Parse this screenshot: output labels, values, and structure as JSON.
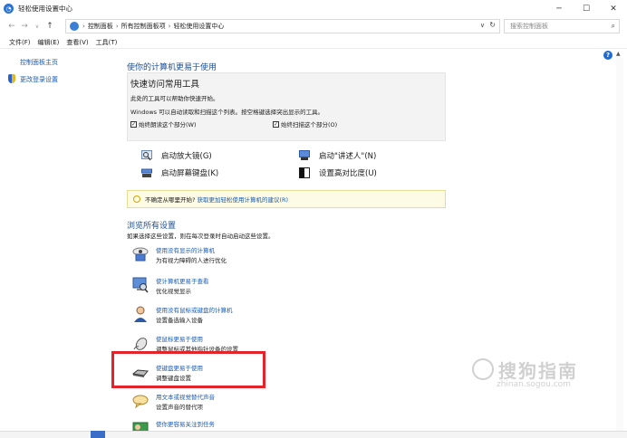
{
  "window": {
    "title": "轻松使用设置中心",
    "controls": {
      "minimize": "─",
      "maximize": "☐",
      "close": "✕"
    }
  },
  "address": {
    "back": "←",
    "forward": "→",
    "up": "↑",
    "crumbs": [
      "控制面板",
      "所有控制面板项",
      "轻松使用设置中心"
    ],
    "separator": "›",
    "dropdown": "∨",
    "refresh": "↻",
    "search_placeholder": "搜索控制面板",
    "search_icon": "⌕"
  },
  "menu": [
    "文件(F)",
    "编辑(E)",
    "查看(V)",
    "工具(T)"
  ],
  "sidebar": {
    "home": "控制面板主页",
    "change_login": "更改登录设置"
  },
  "help": "?",
  "main": {
    "heading": "使你的计算机更易于使用",
    "quick": {
      "title": "快速访问常用工具",
      "line1": "此处的工具可以帮助你快速开始。",
      "line2": "Windows 可以自动读取和扫描这个列表。按空格键选择突出显示的工具。",
      "check1": "始终朗读这个部分(W)",
      "check2": "始终扫描这个部分(O)",
      "checkmark": "✓"
    },
    "tools": {
      "magnifier": "启动放大镜(G)",
      "narrator": "启动\"讲述人\"(N)",
      "osk": "启动屏幕键盘(K)",
      "contrast": "设置高对比度(U)"
    },
    "tip": {
      "text": "不确定从哪里开始?",
      "link": "获取更加轻松使用计算机的建议(R)"
    },
    "browse_heading": "浏览所有设置",
    "browse_sub": "如果选择这些设置，则在每次登录时自动启动这些设置。",
    "settings": [
      {
        "link": "使用没有显示的计算机",
        "desc": "为有视力障碍的人进行优化"
      },
      {
        "link": "使计算机更易于查看",
        "desc": "优化视觉显示"
      },
      {
        "link": "使用没有鼠标或键盘的计算机",
        "desc": "设置备选输入设备"
      },
      {
        "link": "使鼠标更易于使用",
        "desc": "调整鼠标或其他指针设备的设置"
      },
      {
        "link": "使键盘更易于使用",
        "desc": "调整键盘设置"
      },
      {
        "link": "用文本或视觉替代声音",
        "desc": "设置声音的替代项"
      },
      {
        "link": "使你更容易关注到任务",
        "desc": ""
      }
    ]
  },
  "watermark": {
    "brand": "搜狗指南",
    "url": "zhinan.sogou.com"
  },
  "colors": {
    "link": "#1a5bb0",
    "heading": "#1e4f96",
    "highlight": "#e5232a",
    "tip_bg": "#fdfbe3"
  }
}
